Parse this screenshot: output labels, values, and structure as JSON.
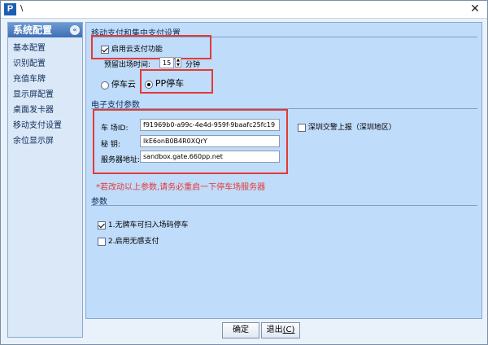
{
  "window": {
    "title": "\\",
    "app_icon_letter": "P",
    "close": "✕"
  },
  "sidebar": {
    "header": "系统配置",
    "collapse": "«",
    "items": [
      {
        "label": "基本配置"
      },
      {
        "label": "识别配置"
      },
      {
        "label": "充值车牌"
      },
      {
        "label": "显示屏配置"
      },
      {
        "label": "桌面发卡器"
      },
      {
        "label": "移动支付设置"
      },
      {
        "label": "余位显示屏"
      }
    ]
  },
  "mobile_pay": {
    "section_title": "移动支付和集中支付设置",
    "cloud_pay_label": "启用云支付功能",
    "cloud_pay_checked": true,
    "exit_time_label": "预留出场时间:",
    "exit_time_value": "15",
    "exit_time_unit": "分钟",
    "mode_options": [
      {
        "label": "停车云",
        "checked": false
      },
      {
        "label": "PP停车",
        "checked": true
      }
    ]
  },
  "e_pay": {
    "section_title": "电子支付参数",
    "lot_id_label": "车    场ID:",
    "lot_id_value": "f91969b0-a99c-4e4d-959f-9baafc25fc19",
    "secret_label": "秘    钥:",
    "secret_value": "lkE6onB0B4R0XQrY",
    "server_label": "服务器地址:",
    "server_value": "sandbox.gate.660pp.net",
    "shenzhen_label": "深圳交警上报（深圳地区）",
    "shenzhen_checked": false,
    "warning": "*若改动以上参数,请务必重启一下停车场服务器"
  },
  "params": {
    "section_title": "参数",
    "options": [
      {
        "label": "1.无牌车可扫入场码停车",
        "checked": true
      },
      {
        "label": "2.启用无感支付",
        "checked": false
      }
    ]
  },
  "footer": {
    "ok_label": "确定",
    "exit_label": "退出",
    "exit_mnemonic": "(C)"
  },
  "colors": {
    "highlight_box": "#e53935",
    "panel_bg": "#bfdcfa",
    "sidebar_header": "#3d6db3"
  }
}
